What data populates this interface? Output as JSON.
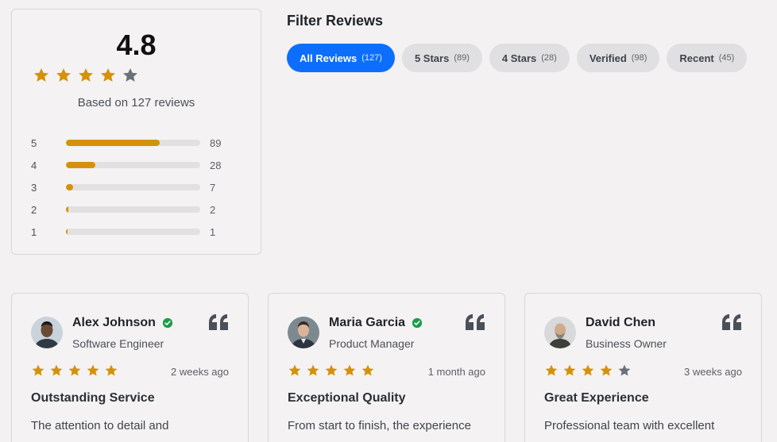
{
  "summary": {
    "average": "4.8",
    "star_fill": [
      1,
      1,
      1,
      1,
      0
    ],
    "based_on": "Based on 127 reviews",
    "distribution": [
      {
        "stars": "5",
        "count": "89",
        "fraction": 0.7
      },
      {
        "stars": "4",
        "count": "28",
        "fraction": 0.22
      },
      {
        "stars": "3",
        "count": "7",
        "fraction": 0.055
      },
      {
        "stars": "2",
        "count": "2",
        "fraction": 0.015
      },
      {
        "stars": "1",
        "count": "1",
        "fraction": 0.008
      }
    ]
  },
  "filters": {
    "title": "Filter Reviews",
    "items": [
      {
        "label": "All Reviews",
        "count": "(127)",
        "active": true
      },
      {
        "label": "5 Stars",
        "count": "(89)",
        "active": false
      },
      {
        "label": "4 Stars",
        "count": "(28)",
        "active": false
      },
      {
        "label": "Verified",
        "count": "(98)",
        "active": false
      },
      {
        "label": "Recent",
        "count": "(45)",
        "active": false
      }
    ]
  },
  "reviews": [
    {
      "name": "Alex Johnson",
      "verified": true,
      "role": "Software Engineer",
      "rating": 5,
      "date": "2 weeks ago",
      "title": "Outstanding Service",
      "text": "The attention to detail and"
    },
    {
      "name": "Maria Garcia",
      "verified": true,
      "role": "Product Manager",
      "rating": 5,
      "date": "1 month ago",
      "title": "Exceptional Quality",
      "text": "From start to finish, the experience"
    },
    {
      "name": "David Chen",
      "verified": false,
      "role": "Business Owner",
      "rating": 4,
      "date": "3 weeks ago",
      "title": "Great Experience",
      "text": "Professional team with excellent"
    }
  ],
  "colors": {
    "star_filled": "#d4920a",
    "star_empty": "#6b7079",
    "accent": "#0d6efd",
    "verified": "#1a9c4a",
    "quote": "#4a5059"
  },
  "icons": {
    "star": "star-icon",
    "verified": "check-circle-icon",
    "quote": "quote-icon"
  }
}
